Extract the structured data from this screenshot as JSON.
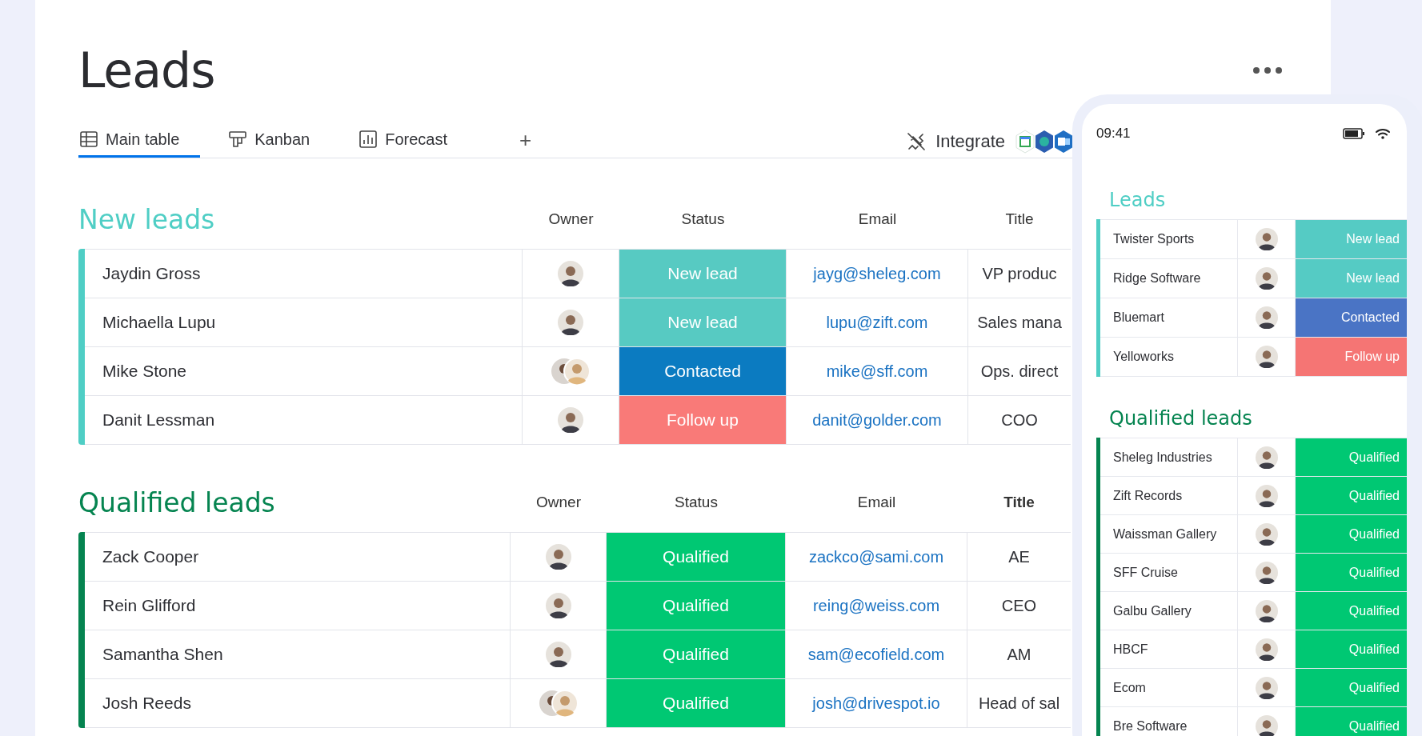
{
  "page": {
    "title": "Leads"
  },
  "tabs": [
    {
      "label": "Main table",
      "kind": "table",
      "selected": true
    },
    {
      "label": "Kanban",
      "kind": "kanban",
      "selected": false
    },
    {
      "label": "Forecast",
      "kind": "chart",
      "selected": false
    }
  ],
  "add_tab": "+",
  "integrate": {
    "label": "Integrate"
  },
  "groups": [
    {
      "title": "New leads",
      "color": "#4fcec5",
      "columns": [
        "Owner",
        "Status",
        "Email",
        "Title"
      ],
      "rows": [
        {
          "name": "Jaydin Gross",
          "kind": "single",
          "status": {
            "label": "New lead",
            "color": "#57cac2"
          },
          "email": "jayg@sheleg.com",
          "title": "VP produc"
        },
        {
          "name": "Michaella Lupu",
          "kind": "single",
          "status": {
            "label": "New lead",
            "color": "#57cac2"
          },
          "email": "lupu@zift.com",
          "title": "Sales mana"
        },
        {
          "name": "Mike Stone",
          "kind": "pair",
          "status": {
            "label": "Contacted",
            "color": "#0b7bc1"
          },
          "email": "mike@sff.com",
          "title": "Ops. direct"
        },
        {
          "name": "Danit Lessman",
          "kind": "single",
          "status": {
            "label": "Follow up",
            "color": "#f97a78"
          },
          "email": "danit@golder.com",
          "title": "COO"
        }
      ]
    },
    {
      "title": "Qualified leads",
      "color": "#058450",
      "columns": [
        "Owner",
        "Status",
        "Email",
        "Title"
      ],
      "rows": [
        {
          "name": "Zack Cooper",
          "kind": "single",
          "status": {
            "label": "Qualified",
            "color": "#00c873"
          },
          "email": "zackco@sami.com",
          "title": "AE"
        },
        {
          "name": "Rein Glifford",
          "kind": "single",
          "status": {
            "label": "Qualified",
            "color": "#00c873"
          },
          "email": "reing@weiss.com",
          "title": "CEO"
        },
        {
          "name": "Samantha Shen",
          "kind": "single",
          "status": {
            "label": "Qualified",
            "color": "#00c873"
          },
          "email": "sam@ecofield.com",
          "title": "AM"
        },
        {
          "name": "Josh Reeds",
          "kind": "pair",
          "status": {
            "label": "Qualified",
            "color": "#00c873"
          },
          "email": "josh@drivespot.io",
          "title": "Head of sal"
        }
      ]
    }
  ],
  "phone": {
    "time": "09:41",
    "groups": [
      {
        "title": "Leads",
        "color": "#4fcec5",
        "rows": [
          {
            "name": "Twister Sports",
            "status": {
              "label": "New lead",
              "color": "#55cbc4"
            }
          },
          {
            "name": "Ridge Software",
            "status": {
              "label": "New lead",
              "color": "#55cbc4"
            }
          },
          {
            "name": "Bluemart",
            "status": {
              "label": "Contacted",
              "color": "#4a74c5"
            }
          },
          {
            "name": "Yelloworks",
            "status": {
              "label": "Follow up",
              "color": "#f57574"
            }
          }
        ]
      },
      {
        "title": "Qualified leads",
        "color": "#058450",
        "rows": [
          {
            "name": "Sheleg Industries",
            "status": {
              "label": "Qualified",
              "color": "#00c873"
            }
          },
          {
            "name": "Zift Records",
            "status": {
              "label": "Qualified",
              "color": "#00c873"
            }
          },
          {
            "name": "Waissman Gallery",
            "status": {
              "label": "Qualified",
              "color": "#00c873"
            }
          },
          {
            "name": "SFF Cruise",
            "status": {
              "label": "Qualified",
              "color": "#00c873"
            }
          },
          {
            "name": "Galbu Gallery",
            "status": {
              "label": "Qualified",
              "color": "#00c873"
            }
          },
          {
            "name": "HBCF",
            "status": {
              "label": "Qualified",
              "color": "#00c873"
            }
          },
          {
            "name": "Ecom",
            "status": {
              "label": "Qualified",
              "color": "#00c873"
            }
          },
          {
            "name": "Bre Software",
            "status": {
              "label": "Qualified",
              "color": "#00c873"
            }
          }
        ]
      }
    ]
  }
}
